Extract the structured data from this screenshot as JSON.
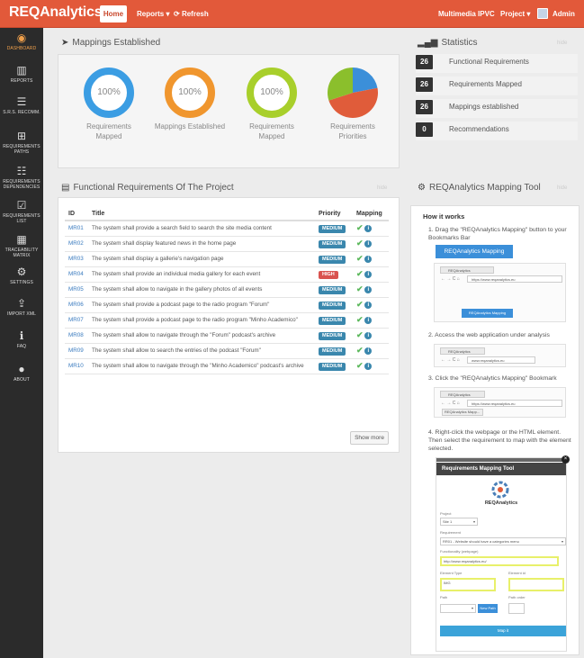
{
  "brand": "REQAnalytics",
  "nav": {
    "home": "Home",
    "reports": "Reports",
    "refresh": "Refresh",
    "workspace": "Multimedia IPVC",
    "project": "Project",
    "user": "Admin"
  },
  "sidebar": [
    {
      "label": "DASHBOARD",
      "icon": "dashboard-icon",
      "glyph": "◉"
    },
    {
      "label": "REPORTS",
      "icon": "bar-chart-icon",
      "glyph": "▥"
    },
    {
      "label": "S.R.S. RECOMM.",
      "icon": "list-icon",
      "glyph": "☰"
    },
    {
      "label": "REQUIREMENTS PATHS",
      "icon": "sitemap-icon",
      "glyph": "⊞"
    },
    {
      "label": "REQUIREMENTS DEPENDENCIES",
      "icon": "indent-icon",
      "glyph": "☷"
    },
    {
      "label": "REQUIREMENTS LIST",
      "icon": "checkbox-icon",
      "glyph": "☑"
    },
    {
      "label": "TRACEABILITY MATRIX",
      "icon": "grid-icon",
      "glyph": "▦"
    },
    {
      "label": "SETTINGS",
      "icon": "gear-icon",
      "glyph": "⚙"
    },
    {
      "label": "IMPORT XML",
      "icon": "upload-icon",
      "glyph": "⇪"
    },
    {
      "label": "FAQ",
      "icon": "info-icon",
      "glyph": "ℹ"
    },
    {
      "label": "ABOUT",
      "icon": "user-icon",
      "glyph": "●"
    }
  ],
  "mappings": {
    "title": "Mappings Established",
    "circles": [
      {
        "value": "100%",
        "progress": 1.0,
        "label": "Requirements Mapped",
        "color": "#3b9de3"
      },
      {
        "value": "100%",
        "progress": 1.0,
        "label": "Mappings Established",
        "color": "#f0962e"
      },
      {
        "value": "100%",
        "progress": 1.0,
        "label": "Requirements Mapped",
        "color": "#a8cf2b"
      }
    ],
    "pie_label": "Requirements Priorities",
    "pie": [
      {
        "color": "#3b8fd9",
        "fraction": 0.22
      },
      {
        "color": "#e05c3a",
        "fraction": 0.48
      },
      {
        "color": "#8bbf2c",
        "fraction": 0.3
      }
    ]
  },
  "statistics": {
    "title": "Statistics",
    "hide": "hide",
    "rows": [
      {
        "num": "26",
        "label": "Functional Requirements"
      },
      {
        "num": "26",
        "label": "Requirements Mapped"
      },
      {
        "num": "26",
        "label": "Mappings established"
      },
      {
        "num": "0",
        "label": "Recommendations"
      }
    ]
  },
  "requirements": {
    "title": "Functional Requirements Of The Project",
    "hide": "hide",
    "columns": [
      "ID",
      "Title",
      "Priority",
      "Mapping"
    ],
    "rows": [
      {
        "id": "MR01",
        "title": "The system shall provide a search field to search the site media content",
        "priority": "MEDIUM"
      },
      {
        "id": "MR02",
        "title": "The system shall display featured news in the home page",
        "priority": "MEDIUM"
      },
      {
        "id": "MR03",
        "title": "The system shall display a gallerie's navigation page",
        "priority": "MEDIUM"
      },
      {
        "id": "MR04",
        "title": "The system shall provide an individual media gallery for each event",
        "priority": "HIGH"
      },
      {
        "id": "MR05",
        "title": "The system shall allow to navigate in the gallery photos of all events",
        "priority": "MEDIUM"
      },
      {
        "id": "MR06",
        "title": "The system shall provide a podcast page to the radio program \"Forum\"",
        "priority": "MEDIUM"
      },
      {
        "id": "MR07",
        "title": "The system shall provide a podcast page to the radio program \"Minho Academico\"",
        "priority": "MEDIUM"
      },
      {
        "id": "MR08",
        "title": "The system shall allow to navigate through the \"Forum\" podcast's archive",
        "priority": "MEDIUM"
      },
      {
        "id": "MR09",
        "title": "The system shall allow to search the entries of the podcast \"Forum\"",
        "priority": "MEDIUM"
      },
      {
        "id": "MR10",
        "title": "The system shall allow to navigate through the \"Minho Academico\" podcast's archive",
        "priority": "MEDIUM"
      }
    ],
    "show_more": "Show more"
  },
  "tool": {
    "title": "REQAnalytics Mapping Tool",
    "hide": "hide",
    "how": "How it works",
    "step1": "1. Drag the \"REQAnalytics Mapping\" button to your Bookmarks Bar",
    "button": "REQAnalytics Mapping",
    "step2": "2. Access the web application under analysis",
    "step3": "3. Click the \"REQAnalytics Mapping\" Bookmark",
    "step4": "4. Right-click the webpage or the HTML element. Then select the requirement to map with the element selected.",
    "browser_tab": "REQAnalytics",
    "url": "https://www.reqanalytics.eu",
    "url2": "www.reqanalytics.eu",
    "bookmark": "REQAnalytics Mapping",
    "bookmark_short": "REQAnalytics Mapp...",
    "dialog": {
      "title": "Requirements Mapping Tool",
      "logo": "REQAnalytics",
      "project_label": "Project",
      "project_value": "Site 1",
      "requirement_label": "Requirement",
      "requirement_value": "RR01 - Website should have a categories menu",
      "url_label": "Functionality (webpage)",
      "url_value": "http://www.reqanalytics.eu/",
      "type_label": "Element Type",
      "type_value": "IMG",
      "id_label": "Element id",
      "path_label": "Path",
      "path_order_label": "Path order",
      "new_path": "New Path",
      "submit": "Map it"
    }
  }
}
